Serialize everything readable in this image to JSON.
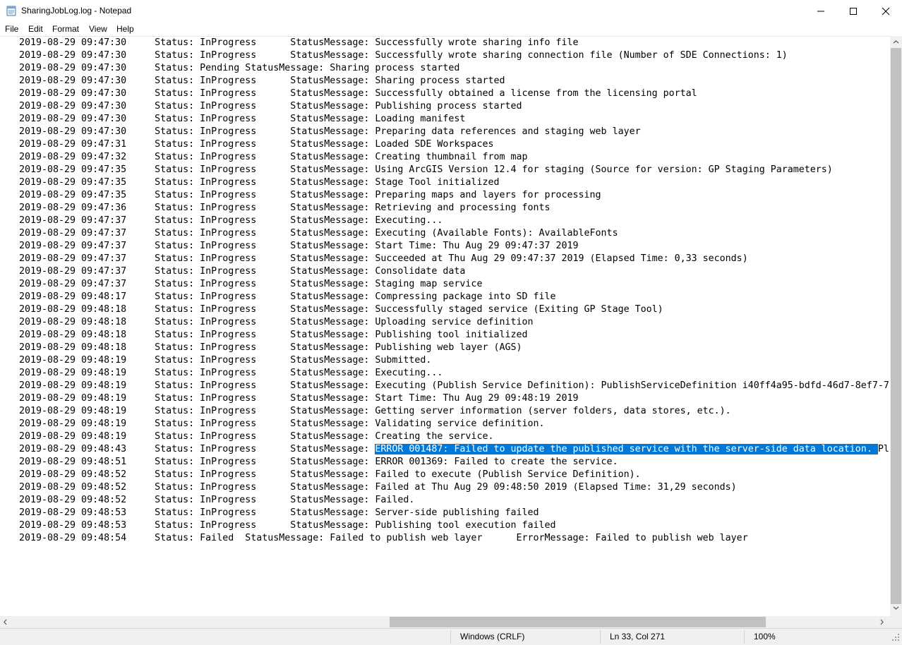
{
  "window": {
    "title": "SharingJobLog.log - Notepad",
    "icon": "notepad-icon"
  },
  "menu": [
    "File",
    "Edit",
    "Format",
    "View",
    "Help"
  ],
  "editor": {
    "lines": [
      "2019-08-29 09:47:30     Status: InProgress      StatusMessage: Successfully wrote sharing info file",
      "2019-08-29 09:47:30     Status: InProgress      StatusMessage: Successfully wrote sharing connection file (Number of SDE Connections: 1)",
      "2019-08-29 09:47:30     Status: Pending StatusMessage: Sharing process started",
      "2019-08-29 09:47:30     Status: InProgress      StatusMessage: Sharing process started",
      "2019-08-29 09:47:30     Status: InProgress      StatusMessage: Successfully obtained a license from the licensing portal",
      "2019-08-29 09:47:30     Status: InProgress      StatusMessage: Publishing process started",
      "2019-08-29 09:47:30     Status: InProgress      StatusMessage: Loading manifest",
      "2019-08-29 09:47:30     Status: InProgress      StatusMessage: Preparing data references and staging web layer",
      "2019-08-29 09:47:31     Status: InProgress      StatusMessage: Loaded SDE Workspaces",
      "2019-08-29 09:47:32     Status: InProgress      StatusMessage: Creating thumbnail from map",
      "2019-08-29 09:47:35     Status: InProgress      StatusMessage: Using ArcGIS Version 12.4 for staging (Source for version: GP Staging Parameters)",
      "2019-08-29 09:47:35     Status: InProgress      StatusMessage: Stage Tool initialized",
      "2019-08-29 09:47:35     Status: InProgress      StatusMessage: Preparing maps and layers for processing",
      "2019-08-29 09:47:36     Status: InProgress      StatusMessage: Retrieving and processing fonts",
      "2019-08-29 09:47:37     Status: InProgress      StatusMessage: Executing...",
      "2019-08-29 09:47:37     Status: InProgress      StatusMessage: Executing (Available Fonts): AvailableFonts",
      "2019-08-29 09:47:37     Status: InProgress      StatusMessage: Start Time: Thu Aug 29 09:47:37 2019",
      "2019-08-29 09:47:37     Status: InProgress      StatusMessage: Succeeded at Thu Aug 29 09:47:37 2019 (Elapsed Time: 0,33 seconds)",
      "2019-08-29 09:47:37     Status: InProgress      StatusMessage: Consolidate data",
      "2019-08-29 09:47:37     Status: InProgress      StatusMessage: Staging map service",
      "2019-08-29 09:48:17     Status: InProgress      StatusMessage: Compressing package into SD file",
      "2019-08-29 09:48:18     Status: InProgress      StatusMessage: Successfully staged service (Exiting GP Stage Tool)",
      "2019-08-29 09:48:18     Status: InProgress      StatusMessage: Uploading service definition",
      "2019-08-29 09:48:18     Status: InProgress      StatusMessage: Publishing tool initialized",
      "2019-08-29 09:48:18     Status: InProgress      StatusMessage: Publishing web layer (AGS)",
      "2019-08-29 09:48:19     Status: InProgress      StatusMessage: Submitted.",
      "2019-08-29 09:48:19     Status: InProgress      StatusMessage: Executing...",
      "2019-08-29 09:48:19     Status: InProgress      StatusMessage: Executing (Publish Service Definition): PublishServiceDefinition i40ff4a95-bdfd-46d7-8ef7-7",
      "2019-08-29 09:48:19     Status: InProgress      StatusMessage: Start Time: Thu Aug 29 09:48:19 2019",
      "2019-08-29 09:48:19     Status: InProgress      StatusMessage: Getting server information (server folders, data stores, etc.).",
      "2019-08-29 09:48:19     Status: InProgress      StatusMessage: Validating service definition.",
      "2019-08-29 09:48:19     Status: InProgress      StatusMessage: Creating the service.",
      "2019-08-29 09:48:43     Status: InProgress      StatusMessage: ",
      "2019-08-29 09:48:51     Status: InProgress      StatusMessage: ERROR 001369: Failed to create the service.",
      "2019-08-29 09:48:52     Status: InProgress      StatusMessage: Failed to execute (Publish Service Definition).",
      "2019-08-29 09:48:52     Status: InProgress      StatusMessage: Failed at Thu Aug 29 09:48:50 2019 (Elapsed Time: 31,29 seconds)",
      "2019-08-29 09:48:52     Status: InProgress      StatusMessage: Failed.",
      "2019-08-29 09:48:53     Status: InProgress      StatusMessage: Server-side publishing failed",
      "2019-08-29 09:48:53     Status: InProgress      StatusMessage: Publishing tool execution failed",
      "2019-08-29 09:48:54     Status: Failed  StatusMessage: Failed to publish web layer      ErrorMessage: Failed to publish web layer"
    ],
    "selected_line_index": 32,
    "selected_text": "ERROR 001487: Failed to update the published service with the server-side data location. ",
    "selected_tail": "Pl",
    "selection_color": "#0078d7"
  },
  "statusbar": {
    "line_ending": "Windows (CRLF)",
    "position": "Ln 33, Col 271",
    "zoom": "100%"
  }
}
